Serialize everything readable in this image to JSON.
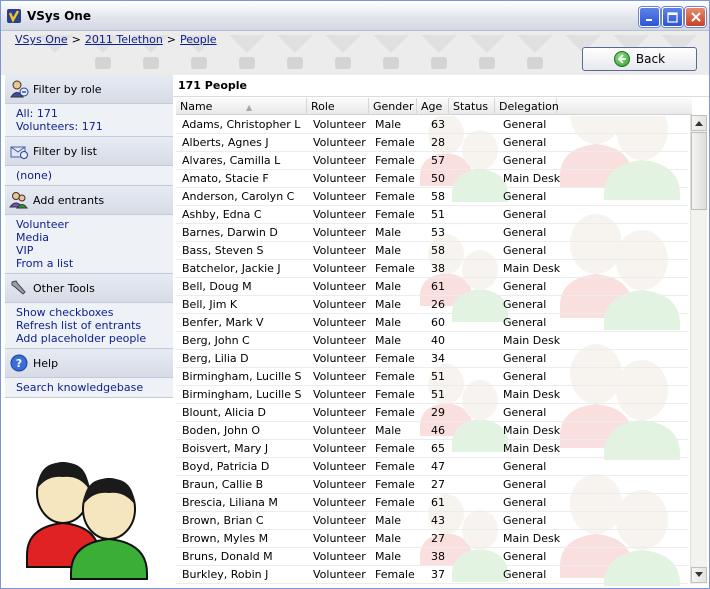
{
  "window": {
    "title": "VSys One"
  },
  "breadcrumb": [
    {
      "label": "VSys One"
    },
    {
      "label": "2011 Telethon"
    },
    {
      "label": "People"
    }
  ],
  "back_button": {
    "label": "Back"
  },
  "sidebar": {
    "filter_by_role": {
      "title": "Filter by role",
      "items": [
        "All: 171",
        "Volunteers: 171"
      ]
    },
    "filter_by_list": {
      "title": "Filter by list",
      "items": [
        "(none)"
      ]
    },
    "add_entrants": {
      "title": "Add entrants",
      "items": [
        "Volunteer",
        "Media",
        "VIP",
        "From a list"
      ]
    },
    "other_tools": {
      "title": "Other Tools",
      "items": [
        "Show checkboxes",
        "Refresh list of entrants",
        "Add placeholder people"
      ]
    },
    "help": {
      "title": "Help",
      "items": [
        "Search knowledgebase"
      ]
    }
  },
  "main": {
    "heading": "171 People",
    "columns": [
      "Name",
      "Role",
      "Gender",
      "Age",
      "Status",
      "Delegation"
    ],
    "sort_indicator": "▲",
    "rows": [
      [
        "Adams, Christopher L",
        "Volunteer",
        "Male",
        "63",
        "",
        "General"
      ],
      [
        "Alberts, Agnes J",
        "Volunteer",
        "Female",
        "28",
        "",
        "General"
      ],
      [
        "Alvares, Camilla L",
        "Volunteer",
        "Female",
        "57",
        "",
        "General"
      ],
      [
        "Amato, Stacie F",
        "Volunteer",
        "Female",
        "50",
        "",
        "Main Desk"
      ],
      [
        "Anderson, Carolyn C",
        "Volunteer",
        "Female",
        "58",
        "",
        "General"
      ],
      [
        "Ashby, Edna C",
        "Volunteer",
        "Female",
        "51",
        "",
        "General"
      ],
      [
        "Barnes, Darwin D",
        "Volunteer",
        "Male",
        "53",
        "",
        "General"
      ],
      [
        "Bass, Steven S",
        "Volunteer",
        "Male",
        "58",
        "",
        "General"
      ],
      [
        "Batchelor, Jackie J",
        "Volunteer",
        "Female",
        "38",
        "",
        "Main Desk"
      ],
      [
        "Bell, Doug M",
        "Volunteer",
        "Male",
        "61",
        "",
        "General"
      ],
      [
        "Bell, Jim K",
        "Volunteer",
        "Male",
        "26",
        "",
        "General"
      ],
      [
        "Benfer, Mark V",
        "Volunteer",
        "Male",
        "60",
        "",
        "General"
      ],
      [
        "Berg, John C",
        "Volunteer",
        "Male",
        "40",
        "",
        "Main Desk"
      ],
      [
        "Berg, Lilia D",
        "Volunteer",
        "Female",
        "34",
        "",
        "General"
      ],
      [
        "Birmingham, Lucille S",
        "Volunteer",
        "Female",
        "51",
        "",
        "General"
      ],
      [
        "Birmingham, Lucille S",
        "Volunteer",
        "Female",
        "51",
        "",
        "Main Desk"
      ],
      [
        "Blount, Alicia D",
        "Volunteer",
        "Female",
        "29",
        "",
        "General"
      ],
      [
        "Boden, John O",
        "Volunteer",
        "Male",
        "46",
        "",
        "Main Desk"
      ],
      [
        "Boisvert, Mary J",
        "Volunteer",
        "Female",
        "65",
        "",
        "Main Desk"
      ],
      [
        "Boyd, Patricia D",
        "Volunteer",
        "Female",
        "47",
        "",
        "General"
      ],
      [
        "Braun, Callie B",
        "Volunteer",
        "Female",
        "27",
        "",
        "General"
      ],
      [
        "Brescia, Liliana M",
        "Volunteer",
        "Female",
        "61",
        "",
        "General"
      ],
      [
        "Brown, Brian C",
        "Volunteer",
        "Male",
        "43",
        "",
        "General"
      ],
      [
        "Brown, Myles M",
        "Volunteer",
        "Male",
        "27",
        "",
        "Main Desk"
      ],
      [
        "Bruns, Donald M",
        "Volunteer",
        "Male",
        "38",
        "",
        "General"
      ],
      [
        "Burkley, Robin J",
        "Volunteer",
        "Female",
        "37",
        "",
        "General"
      ]
    ]
  },
  "icons": {
    "app": "vsys-app-icon",
    "filter_by_role": "people-filter-icon",
    "filter_by_list": "list-filter-icon",
    "add_entrants": "add-people-icon",
    "other_tools": "wrench-icon",
    "help": "help-icon",
    "back": "back-arrow-icon"
  },
  "colors": {
    "link": "#0b1f8f",
    "section_bg": "#dfe3ec",
    "back_green": "#2d9b2c"
  }
}
